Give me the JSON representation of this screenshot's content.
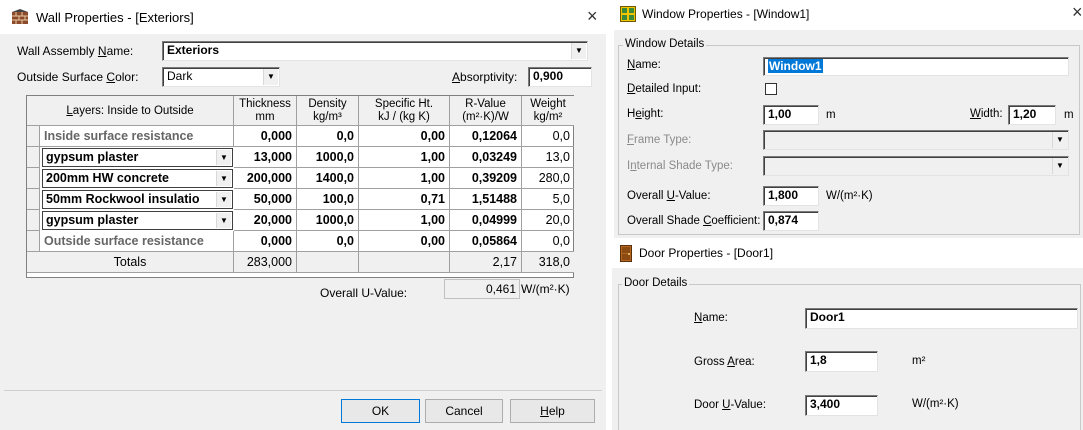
{
  "wall": {
    "title": "Wall Properties - [Exteriors]",
    "assembly_label_pre": "Wall Assembly ",
    "assembly_label_u": "N",
    "assembly_label_post": "ame:",
    "assembly_value": "Exteriors",
    "surface_color_label_pre": "Outside Surface ",
    "surface_color_label_u": "C",
    "surface_color_label_post": "olor:",
    "surface_color_value": "Dark",
    "absorptivity_label_u": "A",
    "absorptivity_label_post": "bsorptivity:",
    "absorptivity_value": "0,900",
    "table": {
      "layers_header_pre": "",
      "layers_header_u": "L",
      "layers_header_post": "ayers: Inside to Outside",
      "headers": [
        {
          "line1": "Thickness",
          "line2": "mm"
        },
        {
          "line1": "Density",
          "line2": "kg/m³"
        },
        {
          "line1": "Specific Ht.",
          "line2": "kJ / (kg K)"
        },
        {
          "line1": "R-Value",
          "line2": "(m²·K)/W"
        },
        {
          "line1": "Weight",
          "line2": "kg/m²"
        }
      ],
      "rows": [
        {
          "name": "Inside surface resistance",
          "thickness": "0,000",
          "density": "0,0",
          "specific_heat": "0,00",
          "r_value": "0,12064",
          "weight": "0,0"
        },
        {
          "name": "gypsum plaster",
          "thickness": "13,000",
          "density": "1000,0",
          "specific_heat": "1,00",
          "r_value": "0,03249",
          "weight": "13,0"
        },
        {
          "name": "200mm HW concrete",
          "thickness": "200,000",
          "density": "1400,0",
          "specific_heat": "1,00",
          "r_value": "0,39209",
          "weight": "280,0"
        },
        {
          "name": "50mm Rockwool insulatio",
          "thickness": "50,000",
          "density": "100,0",
          "specific_heat": "0,71",
          "r_value": "1,51488",
          "weight": "5,0"
        },
        {
          "name": "gypsum plaster",
          "thickness": "20,000",
          "density": "1000,0",
          "specific_heat": "1,00",
          "r_value": "0,04999",
          "weight": "20,0"
        },
        {
          "name": "Outside surface resistance",
          "thickness": "0,000",
          "density": "0,0",
          "specific_heat": "0,00",
          "r_value": "0,05864",
          "weight": "0,0"
        }
      ],
      "totals": {
        "label": "Totals",
        "thickness": "283,000",
        "r_value": "2,17",
        "weight": "318,0"
      }
    },
    "overall_u_label": "Overall U-Value:",
    "overall_u_value": "0,461",
    "overall_u_unit": "W/(m²·K)",
    "ok_label": "OK",
    "cancel_label": "Cancel",
    "help_label_u": "H",
    "help_label_post": "elp"
  },
  "window": {
    "title": "Window Properties - [Window1]",
    "group_label": "Window Details",
    "name_label_u": "N",
    "name_label_post": "ame:",
    "name_value": "Window1",
    "detailed_label_pre": "",
    "detailed_label_u": "D",
    "detailed_label_post": "etailed Input:",
    "height_label_pre": "H",
    "height_label_u": "e",
    "height_label_post": "ight:",
    "height_value": "1,00",
    "height_unit": "m",
    "width_label_u": "W",
    "width_label_post": "idth:",
    "width_value": "1,20",
    "width_unit": "m",
    "frame_type_label_u": "F",
    "frame_type_label_post": "rame Type:",
    "shade_type_label_pre": "I",
    "shade_type_label_u": "n",
    "shade_type_label_post": "ternal Shade Type:",
    "u_value_label_pre": "Overall ",
    "u_value_label_u": "U",
    "u_value_label_post": "-Value:",
    "u_value": "1,800",
    "u_unit": "W/(m²·K)",
    "shade_coeff_label_pre": "Overall Shade ",
    "shade_coeff_label_u": "C",
    "shade_coeff_label_post": "oefficient:",
    "shade_coeff_value": "0,874"
  },
  "door": {
    "title": "Door Properties - [Door1]",
    "group_label": "Door Details",
    "name_label_u": "N",
    "name_label_post": "ame:",
    "name_value": "Door1",
    "area_label_pre": "Gross ",
    "area_label_u": "A",
    "area_label_post": "rea:",
    "area_value": "1,8",
    "area_unit": "m²",
    "u_label_pre": "Door ",
    "u_label_u": "U",
    "u_label_post": "-Value:",
    "u_value": "3,400",
    "u_unit": "W/(m²·K)"
  },
  "icons": {
    "close": "×",
    "dropdown": "▼"
  }
}
